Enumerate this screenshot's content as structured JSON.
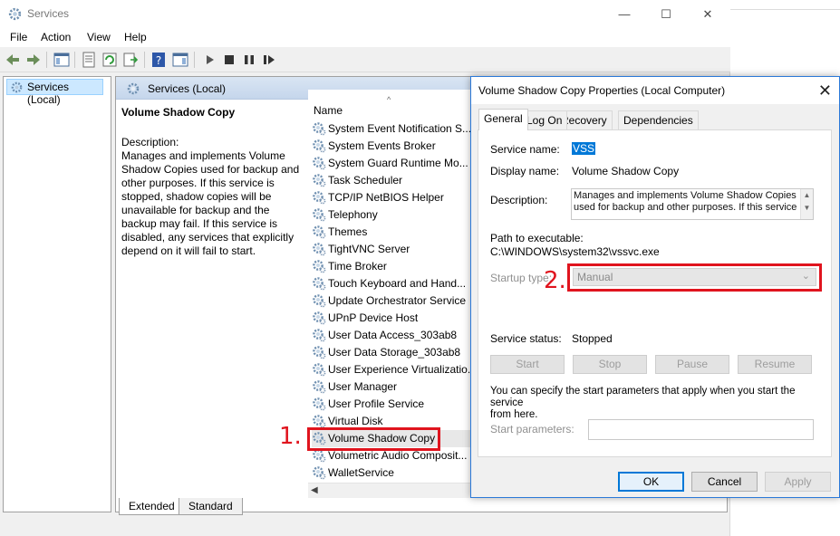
{
  "window": {
    "title": "Services",
    "caption": {
      "minimize": "—",
      "maximize": "☐",
      "close": "✕"
    }
  },
  "menu": [
    "File",
    "Action",
    "View",
    "Help"
  ],
  "tree": {
    "root": "Services (Local)"
  },
  "pane": {
    "header": "Services (Local)",
    "selected_title": "Volume Shadow Copy",
    "description_label": "Description:",
    "description_lines": [
      "Manages and implements Volume",
      "Shadow Copies used for backup and",
      "other purposes. If this service is",
      "stopped, shadow copies will be",
      "unavailable for backup and the",
      "backup may fail. If this service is",
      "disabled, any services that explicitly",
      "depend on it will fail to start."
    ]
  },
  "list": {
    "column_name": "Name",
    "sort_glyph": "^",
    "services": [
      "System Event Notification S...",
      "System Events Broker",
      "System Guard Runtime Mo...",
      "Task Scheduler",
      "TCP/IP NetBIOS Helper",
      "Telephony",
      "Themes",
      "TightVNC Server",
      "Time Broker",
      "Touch Keyboard and Hand...",
      "Update Orchestrator Service",
      "UPnP Device Host",
      "User Data Access_303ab8",
      "User Data Storage_303ab8",
      "User Experience Virtualizatio...",
      "User Manager",
      "User Profile Service",
      "Virtual Disk",
      "Volume Shadow Copy",
      "Volumetric Audio Composit...",
      "WalletService"
    ],
    "selected_index": 18
  },
  "bottom_tabs": [
    "Extended",
    "Standard"
  ],
  "annotations": {
    "first": "1.",
    "second": "2."
  },
  "dialog": {
    "title": "Volume Shadow Copy Properties (Local Computer)",
    "close_glyph": "✕",
    "tabs": [
      "General",
      "Log On",
      "Recovery",
      "Dependencies"
    ],
    "service_name_label": "Service name:",
    "service_name": "VSS",
    "display_name_label": "Display name:",
    "display_name": "Volume Shadow Copy",
    "description_label": "Description:",
    "description_lines": [
      "Manages and implements Volume Shadow Copies",
      "used for backup and other purposes. If this service"
    ],
    "path_label": "Path to executable:",
    "path": "C:\\WINDOWS\\system32\\vssvc.exe",
    "startup_type_label": "Startup type:",
    "startup_type": "Manual",
    "status_label": "Service status:",
    "status": "Stopped",
    "buttons": {
      "start": "Start",
      "stop": "Stop",
      "pause": "Pause",
      "resume": "Resume"
    },
    "hint_lines": [
      "You can specify the start parameters that apply when you start the service",
      "from here."
    ],
    "start_params_label": "Start parameters:",
    "start_params_value": "",
    "ok": "OK",
    "cancel": "Cancel",
    "apply": "Apply"
  },
  "colors": {
    "annotation": "#e0141e",
    "selection": "#0078d7",
    "header_gradient": "#c5d6ec"
  }
}
